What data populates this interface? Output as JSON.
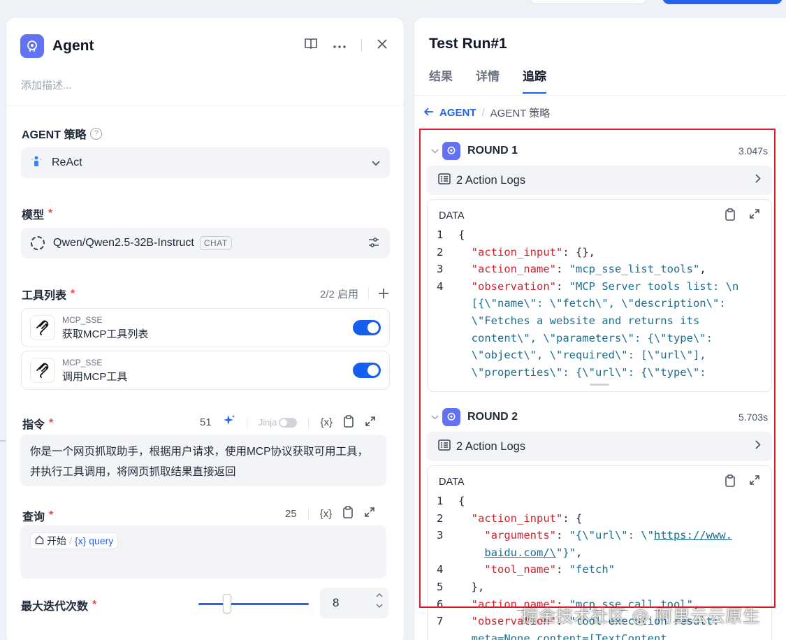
{
  "agent_panel": {
    "title": "Agent",
    "description_placeholder": "添加描述...",
    "strategy": {
      "label": "AGENT 策略",
      "value": "ReAct"
    },
    "model": {
      "label": "模型",
      "value": "Qwen/Qwen2.5-32B-Instruct",
      "badge": "CHAT"
    },
    "tools": {
      "label": "工具列表",
      "enabled_count": "2/2 启用",
      "items": [
        {
          "provider": "MCP_SSE",
          "name": "获取MCP工具列表",
          "enabled": true
        },
        {
          "provider": "MCP_SSE",
          "name": "调用MCP工具",
          "enabled": true
        }
      ]
    },
    "instruction": {
      "label": "指令",
      "count": "51",
      "jinja_label": "Jinja",
      "var_icon": "{x}",
      "text": "你是一个网页抓取助手，根据用户请求，使用MCP协议获取可用工具，并执行工具调用，将网页抓取结果直接返回"
    },
    "query": {
      "label": "查询",
      "count": "25",
      "var_icon": "{x}",
      "chip_node": "开始",
      "chip_sep": "/",
      "chip_var_icon": "{x}",
      "chip_var": "query"
    },
    "max_iterations": {
      "label": "最大迭代次数",
      "value": "8",
      "slider_fraction": 0.25
    }
  },
  "run_panel": {
    "title": "Test Run#1",
    "tabs": [
      "结果",
      "详情",
      "追踪"
    ],
    "active_tab": 2,
    "breadcrumb": {
      "back": "AGENT",
      "sep": "/",
      "current": "AGENT 策略"
    },
    "rounds": [
      {
        "title": "ROUND 1",
        "time": "3.047s",
        "action_logs": "2 Action Logs",
        "data_label": "DATA"
      },
      {
        "title": "ROUND 2",
        "time": "5.703s",
        "action_logs": "2 Action Logs",
        "data_label": "DATA"
      }
    ]
  },
  "watermark": "掘金技术社区 @ 阿里云云原生",
  "icons": {
    "agent": "agent-brain-icon",
    "book": "book-icon",
    "more": "more-dots-icon",
    "close": "close-icon",
    "help": "help-circle-icon",
    "react": "react-strategy-icon",
    "chevron": "chevron-down-icon",
    "model": "model-icon",
    "tune": "settings-sliders-icon",
    "plus": "plus-icon",
    "tool": "mcp-tool-icon",
    "sparkle": "sparkle-icon",
    "clipboard": "clipboard-icon",
    "expand": "expand-icon",
    "home": "home-icon",
    "back": "arrow-left-icon",
    "list": "list-icon",
    "chevron_right": "chevron-right-icon"
  },
  "colors": {
    "accent": "#155eef",
    "agent_logo": "#6172f3",
    "required": "#ef4444",
    "highlight": "#e11d2a"
  }
}
